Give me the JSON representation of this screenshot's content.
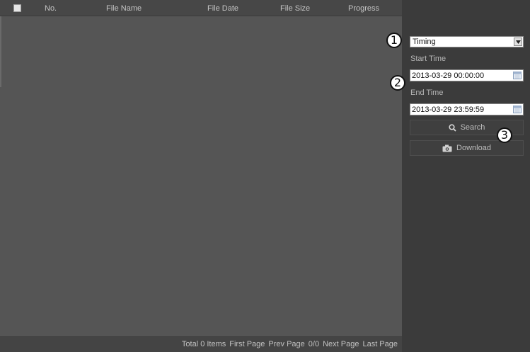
{
  "table": {
    "columns": [
      "No.",
      "File Name",
      "File Date",
      "File Size",
      "Progress"
    ],
    "rows": []
  },
  "pager": {
    "total": "Total 0 Items",
    "first": "First Page",
    "prev": "Prev Page",
    "page": "0/0",
    "next": "Next Page",
    "last": "Last Page"
  },
  "side": {
    "mode_select": "Timing",
    "start_label": "Start Time",
    "start_value": "2013-03-29 00:00:00",
    "end_label": "End Time",
    "end_value": "2013-03-29 23:59:59",
    "search_label": "Search",
    "download_label": "Download"
  },
  "callouts": [
    "1",
    "2",
    "3"
  ]
}
